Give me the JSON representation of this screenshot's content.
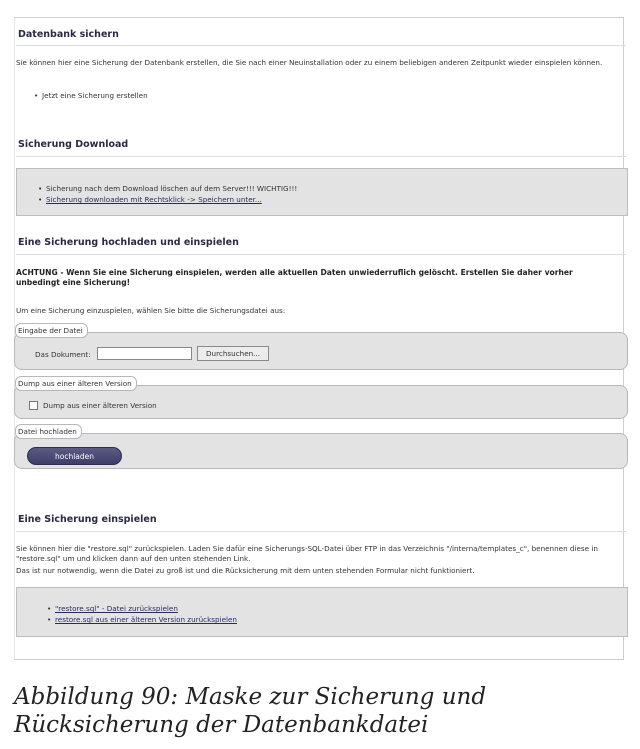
{
  "sections": {
    "backup": {
      "title": "Datenbank sichern",
      "description": "Sie können hier eine Sicherung der Datenbank erstellen, die Sie nach einer Neuinstallation oder zu einem beliebigen anderen Zeitpunkt wieder einspielen können.",
      "create_link": "Jetzt eine Sicherung erstellen"
    },
    "download": {
      "title": "Sicherung Download",
      "items": [
        "Sicherung nach dem Download löschen auf dem Server!!! WICHTIG!!!",
        "Sicherung downloaden mit Rechtsklick -> Speichern unter..."
      ]
    },
    "upload": {
      "title": "Eine Sicherung hochladen und einspielen",
      "warning": "ACHTUNG - Wenn Sie eine Sicherung einspielen, werden alle aktuellen Daten unwiederruflich gelöscht. Erstellen Sie daher vorher unbedingt eine Sicherung!",
      "instruction": "Um eine Sicherung einzuspielen, wählen Sie bitte die Sicherungsdatei aus:",
      "file_fieldset": {
        "legend": "Eingabe der Datei",
        "label": "Das Dokument:",
        "value": "",
        "browse_label": "Durchsuchen..."
      },
      "dump_fieldset": {
        "legend": "Dump aus einer älteren Version",
        "checkbox_label": "Dump aus einer älteren Version",
        "checked": false
      },
      "submit_fieldset": {
        "legend": "Datei hochladen",
        "button_label": "hochladen"
      }
    },
    "restore": {
      "title": "Eine Sicherung einspielen",
      "description_1": "Sie können hier die \"restore.sql\" zurückspielen. Laden Sie dafür eine Sicherungs-SQL-Datei über FTP in das Verzeichnis \"/interna/templates_c\", benennen diese in \"restore.sql\" um und klicken dann auf den unten stehenden Link.",
      "description_2": "Das ist nur notwendig, wenn die Datei zu groß ist und die Rücksicherung mit dem unten stehenden Formular nicht funktioniert.",
      "items": [
        "\"restore.sql\" - Datei zurückspielen",
        "restore.sql aus einer älteren Version zurückspielen"
      ]
    }
  },
  "caption": "Abbildung 90: Maske zur Sicherung und Rücksicherung der Datenbankdatei"
}
